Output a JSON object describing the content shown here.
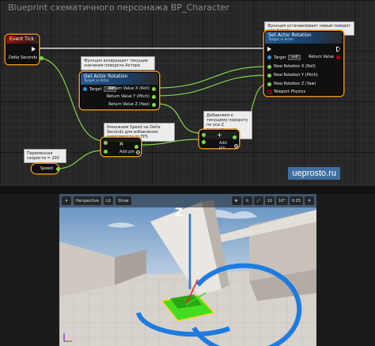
{
  "graph": {
    "title": "Blueprint схематичного персонажа BP_Character",
    "watermark": "ueprosto.ru"
  },
  "nodes": {
    "event_tick": {
      "title": "Event Tick",
      "pin_delta": "Delta Seconds"
    },
    "get_rotation": {
      "title": "Get Actor Rotation",
      "subtitle": "Target is Actor",
      "target": "Target",
      "target_value": "self",
      "out_x": "Return Value X (Roll)",
      "out_y": "Return Value Y (Pitch)",
      "out_z": "Return Value Z (Yaw)"
    },
    "set_rotation": {
      "title": "Set Actor Rotation",
      "subtitle": "Target is Actor",
      "target": "Target",
      "target_value": "self",
      "return_value": "Return Value",
      "new_x": "New Rotation X (Roll)",
      "new_y": "New Rotation Y (Pitch)",
      "new_z": "New Rotation Z (Yaw)",
      "teleport": "Teleport Physics"
    },
    "multiply": {
      "op": "×",
      "add_pin": "Add pin"
    },
    "add": {
      "op": "+",
      "add_pin": "Add pin"
    },
    "speed": {
      "label": "Speed"
    }
  },
  "comments": {
    "set_rotation": "Функция устанавливает новый поворот для Актора",
    "get_rotation": "Функция возвращает текущие значения поворота Актора",
    "multiply": "Умножаем Speed на Delta Seconds для избавления зависимости от FPS",
    "add": "Добавляем к текущему повороту по оси Z рассчитанную дельту",
    "speed": "Переменная скорости = 200"
  },
  "viewport": {
    "mode": "Perspective",
    "lit": "Lit",
    "show": "Show",
    "gizmo_label": "Z",
    "grid_snap": "10",
    "angle_snap": "10°",
    "scale_snap": "0.25",
    "cam_speed": "4"
  },
  "colors": {
    "exec_wire": "#ffffff",
    "float_wire": "#7fd44d",
    "object_wire": "#2f8fe6",
    "node_outline": "#e3901f",
    "gizmo": "#1e7be0",
    "actor_highlight": "#44dd22"
  }
}
